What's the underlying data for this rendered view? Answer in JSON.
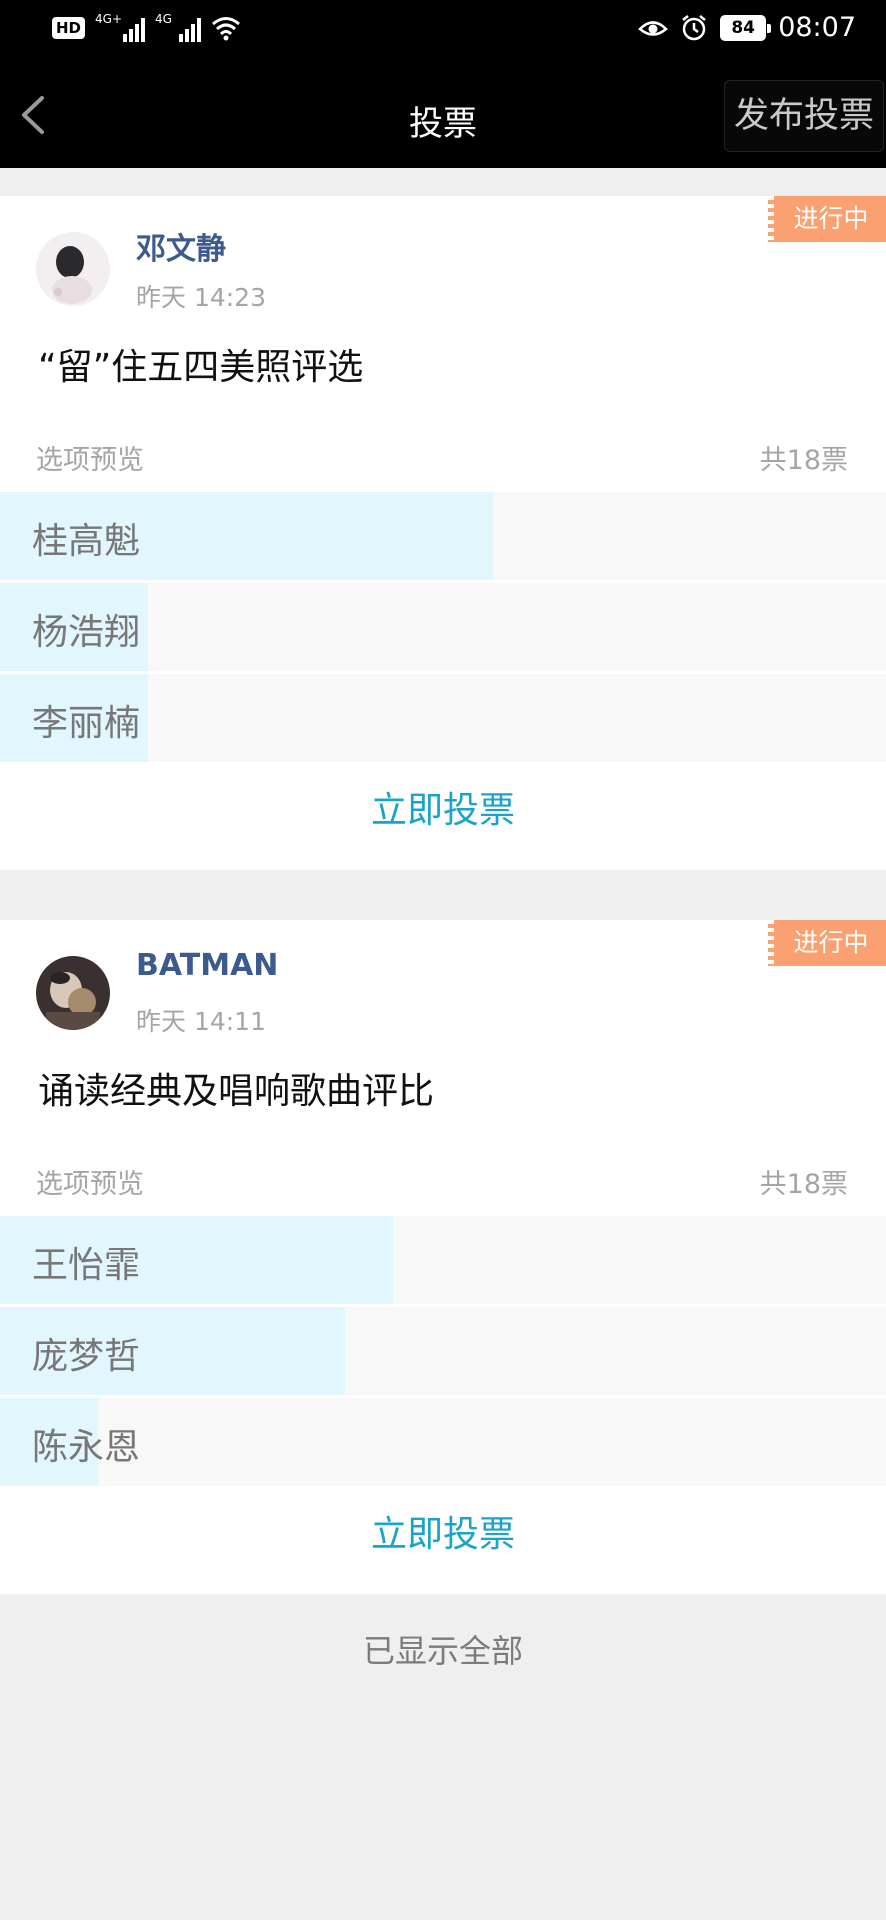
{
  "status_bar": {
    "hd": "HD",
    "network1": "4G+",
    "network2": "4G",
    "battery": "84",
    "time": "08:07"
  },
  "nav": {
    "title": "投票",
    "publish_label": "发布投票"
  },
  "polls": [
    {
      "author": "邓文静",
      "time": "昨天 14:23",
      "status": "进行中",
      "title": "“留”住五四美照评选",
      "preview_label": "选项预览",
      "total": "共18票",
      "options": [
        {
          "label": "桂高魁",
          "share": 0.556
        },
        {
          "label": "杨浩翔",
          "share": 0.167
        },
        {
          "label": "李丽楠",
          "share": 0.167
        }
      ],
      "vote_label": "立即投票"
    },
    {
      "author": "BATMAN",
      "time": "昨天 14:11",
      "status": "进行中",
      "title": "诵读经典及唱响歌曲评比",
      "preview_label": "选项预览",
      "total": "共18票",
      "options": [
        {
          "label": "王怡霏",
          "share": 0.444
        },
        {
          "label": "庞梦哲",
          "share": 0.389
        },
        {
          "label": "陈永恩",
          "share": 0.111
        }
      ],
      "vote_label": "立即投票"
    }
  ],
  "footer": "已显示全部"
}
